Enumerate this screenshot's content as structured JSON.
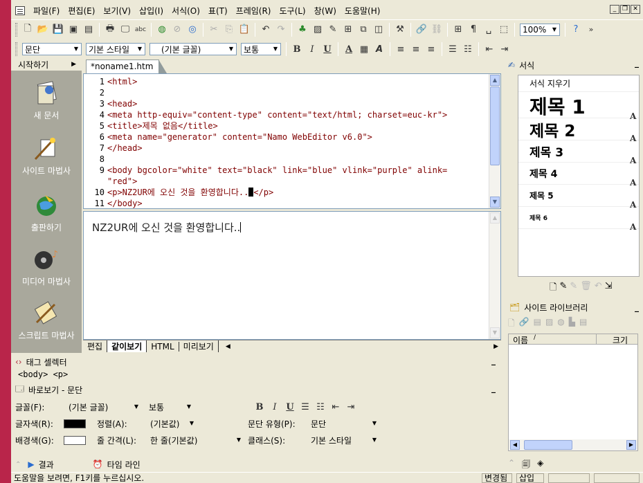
{
  "menu": [
    "파일(F)",
    "편집(E)",
    "보기(V)",
    "삽입(I)",
    "서식(O)",
    "표(T)",
    "프레임(R)",
    "도구(L)",
    "창(W)",
    "도움말(H)"
  ],
  "toolbar": {
    "zoom": "100%"
  },
  "format_bar": {
    "paragraph": "문단",
    "style": "기본 스타일",
    "font": "(기본 글꼴)",
    "size": "보통",
    "bold": "B",
    "italic": "I",
    "underline": "U"
  },
  "left_panel": {
    "title": "시작하기",
    "items": [
      "새 문서",
      "사이트 마법사",
      "출판하기",
      "미디어 마법사",
      "스크립트 마법사"
    ]
  },
  "document_tab": "*noname1.htm",
  "code_lines": [
    {
      "n": "1",
      "text": "<html>"
    },
    {
      "n": "2",
      "text": ""
    },
    {
      "n": "3",
      "text": "<head>"
    },
    {
      "n": "4",
      "text": "<meta http-equiv=\"content-type\" content=\"text/html; charset=euc-kr\">"
    },
    {
      "n": "5",
      "text": "<title>제목 없음</title>"
    },
    {
      "n": "6",
      "text": "<meta name=\"generator\" content=\"Namo WebEditor v6.0\">"
    },
    {
      "n": "7",
      "text": "</head>"
    },
    {
      "n": "8",
      "text": ""
    },
    {
      "n": "9",
      "text": "<body bgcolor=\"white\" text=\"black\" link=\"blue\" vlink=\"purple\" alink="
    },
    {
      "n": "",
      "text": "\"red\">"
    },
    {
      "n": "10",
      "text_before": "<p>NZ2UR에 오신 것을 환영합니다..",
      "text_after": "</p>"
    },
    {
      "n": "11",
      "text": "</body>"
    }
  ],
  "preview_text": "NZ2UR에 오신 것을 환영합니다..",
  "view_tabs": [
    "편집",
    "같이보기",
    "HTML",
    "미리보기"
  ],
  "tag_selector": {
    "title": "태그 셀렉터",
    "path": "<body> <p>"
  },
  "quick_props": {
    "title": "바로보기 - 문단",
    "font_label": "글꼴(F):",
    "font_value": "(기본 글꼴)",
    "size_value": "보통",
    "color_label": "글자색(R):",
    "align_label": "정렬(A):",
    "align_value": "(기본값)",
    "para_type_label": "문단 유형(P):",
    "para_type_value": "문단",
    "bg_label": "배경색(G):",
    "spacing_label": "줄 간격(L):",
    "spacing_value": "한 줄(기본값)",
    "class_label": "클래스(S):",
    "class_value": "기본 스타일"
  },
  "bottom_tabs": [
    "결과",
    "타임 라인"
  ],
  "status": {
    "help": "도움말을 보려면, F1키를 누르십시오.",
    "changed": "변경됨",
    "insert": "삽입"
  },
  "styles_panel": {
    "title": "서식",
    "clear": "서식 지우기",
    "headings": [
      "제목 1",
      "제목 2",
      "제목 3",
      "제목 4",
      "제목 5",
      "제목 6"
    ]
  },
  "library_panel": {
    "title": "사이트 라이브러리",
    "col_name": "이름",
    "col_size": "크기"
  },
  "colors": {
    "text_color": "#000000",
    "bg_color": "#ffffff",
    "code_color": "#800000"
  }
}
